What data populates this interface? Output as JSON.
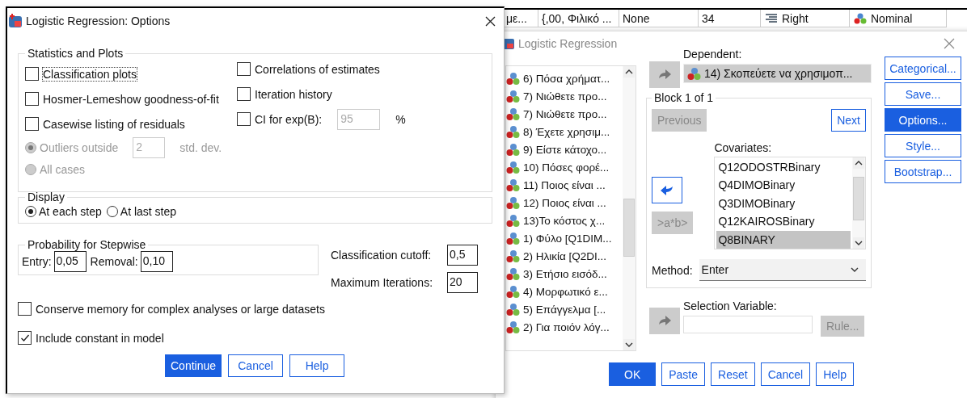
{
  "data_grid": {
    "cells": [
      "με...",
      "{,00, Φιλικό ...",
      "None",
      "34",
      "Right",
      "Nominal"
    ]
  },
  "options_dialog": {
    "title": "Logistic Regression: Options",
    "statistics": {
      "title": "Statistics and Plots",
      "left_checks": [
        {
          "label": "Classification plots",
          "checked": false,
          "focused": true
        },
        {
          "label": "Hosmer-Lemeshow goodness-of-fit",
          "checked": false,
          "focused": false
        },
        {
          "label": "Casewise listing of residuals",
          "checked": false,
          "focused": false
        }
      ],
      "residual_options": [
        {
          "label": "Outliers outside",
          "selected": true,
          "disabled": true,
          "value": "2",
          "unit": "std. dev."
        },
        {
          "label": "All cases",
          "selected": false,
          "disabled": true
        }
      ],
      "right_checks": [
        {
          "label": "Correlations of estimates",
          "checked": false
        },
        {
          "label": "Iteration history",
          "checked": false
        },
        {
          "label": "CI for exp(B):",
          "checked": false,
          "value": "95",
          "value_disabled": true,
          "unit": "%"
        }
      ]
    },
    "display": {
      "title": "Display",
      "options": [
        {
          "label": "At each step",
          "selected": true
        },
        {
          "label": "At last step",
          "selected": false
        }
      ]
    },
    "stepwise": {
      "title": "Probability for Stepwise",
      "fields": [
        {
          "label": "Entry:",
          "value": "0,05"
        },
        {
          "label": "Removal:",
          "value": "0,10"
        }
      ]
    },
    "settings": [
      {
        "label": "Classification cutoff:",
        "value": "0,5"
      },
      {
        "label": "Maximum Iterations:",
        "value": "20"
      }
    ],
    "checks": [
      {
        "label": "Conserve memory for complex analyses or large datasets",
        "checked": false
      },
      {
        "label": "Include constant in model",
        "checked": true
      }
    ],
    "buttons": [
      {
        "label": "Continue",
        "primary": true
      },
      {
        "label": "Cancel",
        "primary": false
      },
      {
        "label": "Help",
        "primary": false
      }
    ]
  },
  "main_dialog": {
    "title": "Logistic Regression",
    "variables": [
      "6) Πόσα χρήματ...",
      "7) Νιώθετε προ...",
      "7) Νιώθετε προ...",
      "8) Έχετε χρησιμ...",
      "9) Είστε κάτοχο...",
      "10) Πόσες φορέ...",
      "11) Ποιος είναι ...",
      "12) Ποιος είναι ...",
      "13)Το κόστος χ...",
      "1) Φύλο [Q1DIM...",
      "2) Ηλικία [Q2DI...",
      "3) Ετήσιο εισόδ...",
      "4) Μορφωτικό ε...",
      "5) Επάγγελμα [...",
      "2) Για ποιόν λόγ..."
    ],
    "dependent_arrow": {
      "disabled": true
    },
    "dependent_label": "Dependent:",
    "dependent": "14) Σκοπεύετε να χρησιμοπ...",
    "block_title": "Block 1 of 1",
    "previous": {
      "label": "Previous",
      "disabled": true
    },
    "next": {
      "label": "Next",
      "disabled": false
    },
    "covariates_label": "Covariates:",
    "covariate_arrow": {
      "disabled": false
    },
    "interaction": {
      "label": ">a*b>",
      "disabled": true
    },
    "covariates": [
      {
        "label": "Q12ODOSTRBinary",
        "selected": false
      },
      {
        "label": "Q4DIMOBinary",
        "selected": false
      },
      {
        "label": "Q3DIMOBinary",
        "selected": false
      },
      {
        "label": "Q12KAIROSBinary",
        "selected": false
      },
      {
        "label": "Q8BINARY",
        "selected": true
      }
    ],
    "method_label": "Method:",
    "method": "Enter",
    "selection_label": "Selection Variable:",
    "selection_arrow": {
      "disabled": true
    },
    "rule": {
      "label": "Rule...",
      "disabled": true
    },
    "side_buttons": [
      {
        "label": "Categorical...",
        "selected": false
      },
      {
        "label": "Save...",
        "selected": false
      },
      {
        "label": "Options...",
        "selected": true
      },
      {
        "label": "Style...",
        "selected": false
      },
      {
        "label": "Bootstrap...",
        "selected": false
      }
    ],
    "buttons": [
      {
        "label": "OK",
        "primary": true
      },
      {
        "label": "Paste",
        "primary": false
      },
      {
        "label": "Reset",
        "primary": false
      },
      {
        "label": "Cancel",
        "primary": false
      },
      {
        "label": "Help",
        "primary": false
      }
    ]
  }
}
